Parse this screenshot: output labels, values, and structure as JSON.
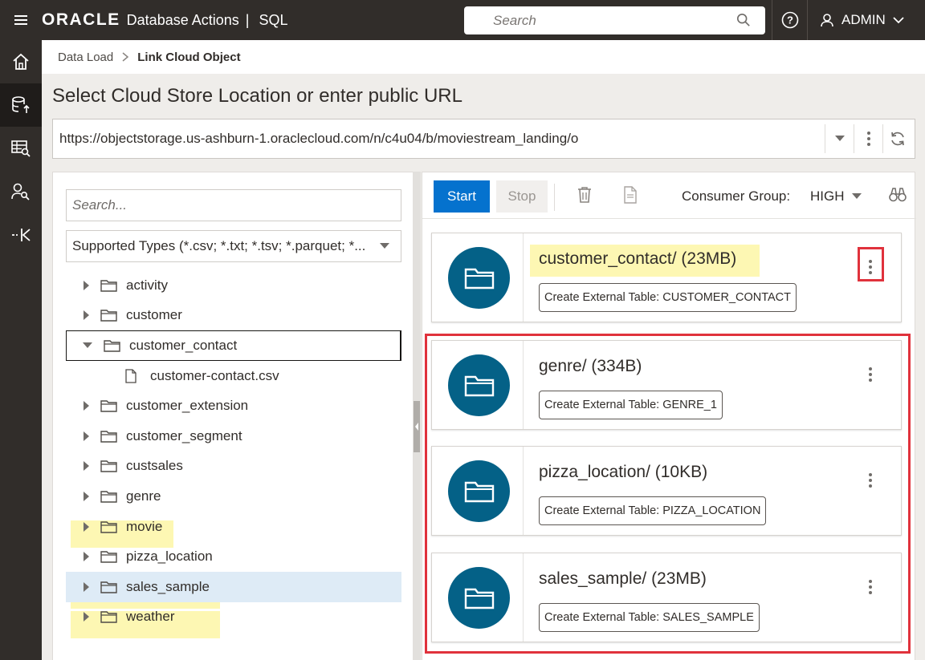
{
  "header": {
    "menu_icon": "hamburger-icon",
    "logo": "ORACLE",
    "app_title": "Database Actions",
    "separator": "|",
    "section": "SQL",
    "search_placeholder": "Search",
    "help_icon": "help-icon",
    "user_label": "ADMIN"
  },
  "leftnav": {
    "items": [
      {
        "icon": "home-icon"
      },
      {
        "icon": "data-load-icon"
      },
      {
        "icon": "catalog-icon"
      },
      {
        "icon": "user-search-icon"
      },
      {
        "icon": "collapse-icon"
      }
    ]
  },
  "breadcrumb": {
    "parent": "Data Load",
    "current": "Link Cloud Object"
  },
  "page": {
    "heading": "Select Cloud Store Location or enter public URL",
    "url": "https://objectstorage.us-ashburn-1.oraclecloud.com/n/c4u04/b/moviestream_landing/o"
  },
  "tree": {
    "search_placeholder": "Search...",
    "type_filter": "Supported Types (*.csv; *.txt; *.tsv; *.parquet; *...",
    "items": [
      {
        "label": "activity"
      },
      {
        "label": "customer"
      },
      {
        "label": "customer_contact"
      },
      {
        "label": "customer-contact.csv"
      },
      {
        "label": "customer_extension"
      },
      {
        "label": "customer_segment"
      },
      {
        "label": "custsales"
      },
      {
        "label": "genre"
      },
      {
        "label": "movie"
      },
      {
        "label": "pizza_location"
      },
      {
        "label": "sales_sample"
      },
      {
        "label": "weather"
      }
    ]
  },
  "toolbar": {
    "start_label": "Start",
    "stop_label": "Stop",
    "consumer_group_label": "Consumer Group:",
    "consumer_group_value": "HIGH"
  },
  "cards": [
    {
      "title": "customer_contact/ (23MB)",
      "action": "Create External Table: CUSTOMER_CONTACT"
    },
    {
      "title": "genre/ (334B)",
      "action": "Create External Table: GENRE_1"
    },
    {
      "title": "pizza_location/ (10KB)",
      "action": "Create External Table: PIZZA_LOCATION"
    },
    {
      "title": "sales_sample/ (23MB)",
      "action": "Create External Table: SALES_SAMPLE"
    }
  ],
  "colors": {
    "topbar": "#312d2a",
    "primary_button": "#0572ce",
    "folder_circle": "#046187",
    "highlight": "#fdf6a6",
    "annotation": "#e0323c",
    "selection": "#deebf6"
  }
}
